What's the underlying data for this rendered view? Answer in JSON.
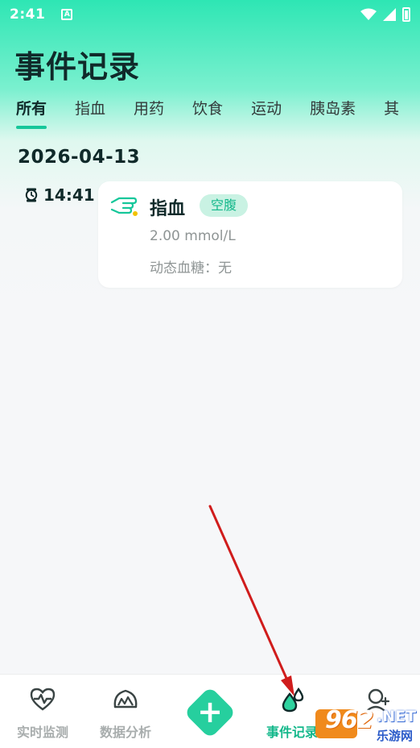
{
  "status_bar": {
    "time": "2:41",
    "notification_letter": "A"
  },
  "page_title": "事件记录",
  "tabs": [
    {
      "label": "所有",
      "active": true
    },
    {
      "label": "指血",
      "active": false
    },
    {
      "label": "用药",
      "active": false
    },
    {
      "label": "饮食",
      "active": false
    },
    {
      "label": "运动",
      "active": false
    },
    {
      "label": "胰岛素",
      "active": false
    },
    {
      "label": "其",
      "active": false
    }
  ],
  "date_heading": "2026-04-13",
  "events": [
    {
      "time": "14:41",
      "type": "指血",
      "tag": "空腹",
      "value": "2.00 mmol/L",
      "cgm": "动态血糖：无",
      "icon": "finger-prick-icon"
    }
  ],
  "bottom_nav": [
    {
      "label": "实时监测",
      "icon": "heart-pulse-icon",
      "active": false
    },
    {
      "label": "数据分析",
      "icon": "gauge-icon",
      "active": false
    },
    {
      "label": "",
      "icon": "plus-icon",
      "active": false
    },
    {
      "label": "事件记录",
      "icon": "event-drops-icon",
      "active": true
    },
    {
      "label": "",
      "icon": "user-add-icon",
      "active": false
    }
  ],
  "watermark": {
    "number": "962",
    "domain": ".NET",
    "site_name": "乐游网"
  },
  "colors": {
    "accent": "#16c79a",
    "tag_bg": "#c9f2e3",
    "arrow": "#d01c1c",
    "title": "#102a2a"
  }
}
